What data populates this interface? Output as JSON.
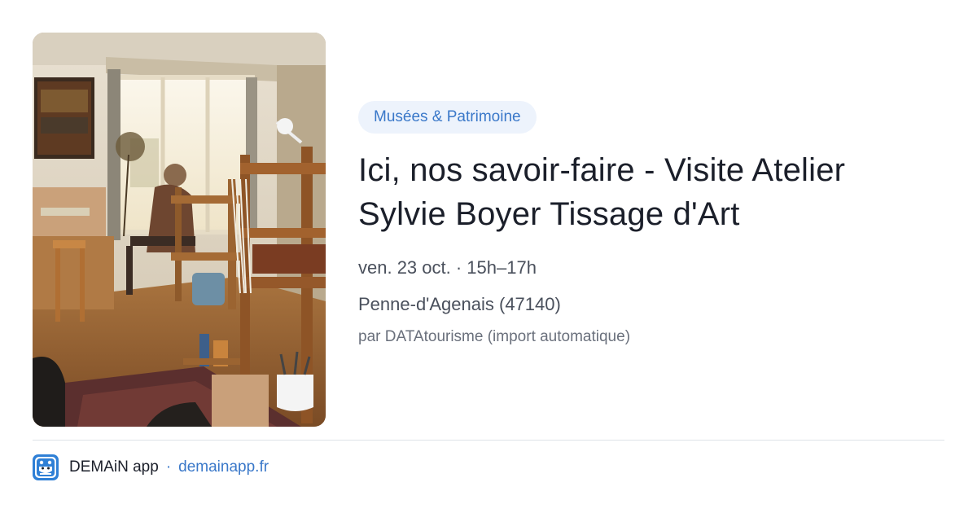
{
  "event": {
    "category": "Musées & Patrimoine",
    "title_lines": [
      "Ici, nos savoir-faire - Visite Atelier",
      "Sylvie Boyer Tissage d'Art"
    ],
    "date": "ven. 23 oct. · 15h–17h",
    "location": "Penne-d'Agenais (47140)",
    "source": "par DATAtourisme (import automatique)"
  },
  "footer": {
    "app_name": "DEMAiN app",
    "separator": "·",
    "domain": "demainapp.fr",
    "icon": "demain-app-logo-icon"
  },
  "colors": {
    "accent": "#3a78c9",
    "tag_background": "#edf3fc",
    "title": "#1b1f2a",
    "meta": "#4a505c",
    "divider": "#dfe3e8"
  }
}
